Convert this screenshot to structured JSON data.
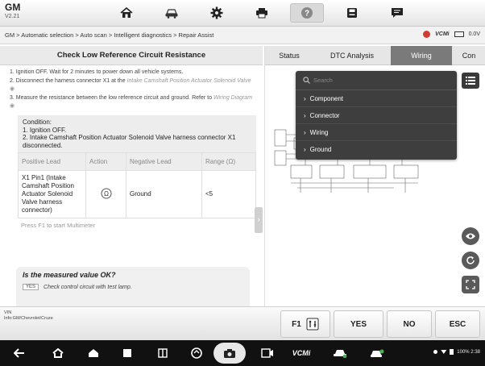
{
  "app": {
    "brand": "GM",
    "version": "V2.21"
  },
  "topbar": {
    "icons": [
      "home-icon",
      "car-icon",
      "gear-icon",
      "printer-icon",
      "help-icon",
      "save-icon",
      "message-icon"
    ]
  },
  "breadcrumb": {
    "path": "GM > Automatic selection > Auto scan > Intelligent diagnostics > Repair Assist",
    "vci_label": "VCMi",
    "voltage": "0.0V"
  },
  "left": {
    "title": "Check Low Reference Circuit Resistance",
    "step1": "1. Ignition OFF. Wait for 2 minutes to power down all vehicle systems.",
    "step2": "2. Disconnect the harness connector X1 at the",
    "step2_link": "Intake Camshaft Position Actuator Solenoid Valve",
    "step3": "3. Measure the resistance between the low reference circuit and ground. Refer to",
    "step3_link": "Wiring Diagram",
    "condition_title": "Condition:",
    "condition_1": "1. Ignition OFF.",
    "condition_2": "2. Intake Camshaft Position Actuator Solenoid Valve harness connector X1 disconnected.",
    "table": {
      "headers": [
        "Positive Lead",
        "Action",
        "Negative Lead",
        "Range (Ω)"
      ],
      "rows": [
        {
          "positive": "X1 Pin1 (Intake Camshaft Position Actuator Solenoid Valve harness connector)",
          "action_icon": "ohm-meter-icon",
          "negative": "Ground",
          "range": "<5"
        }
      ]
    },
    "press_hint": "Press F1 to start Multimeter",
    "question": "Is the measured value OK?",
    "yes_tag": "YES",
    "yes_text": "Check control circuit with test lamp."
  },
  "right": {
    "tabs": [
      "Status",
      "DTC Analysis",
      "Wiring",
      "Con"
    ],
    "active_tab": "Wiring",
    "search_placeholder": "Search",
    "menu": [
      "Component",
      "Connector",
      "Wiring",
      "Ground"
    ]
  },
  "footer": {
    "vin_label": "VIN",
    "vehicle_info": "Info:GM/Chevrolet/Cruze",
    "f1_label": "F1",
    "yes_label": "YES",
    "no_label": "NO",
    "esc_label": "ESC"
  },
  "android": {
    "vci_label": "VCMi",
    "status_text": "100%  2:38"
  }
}
